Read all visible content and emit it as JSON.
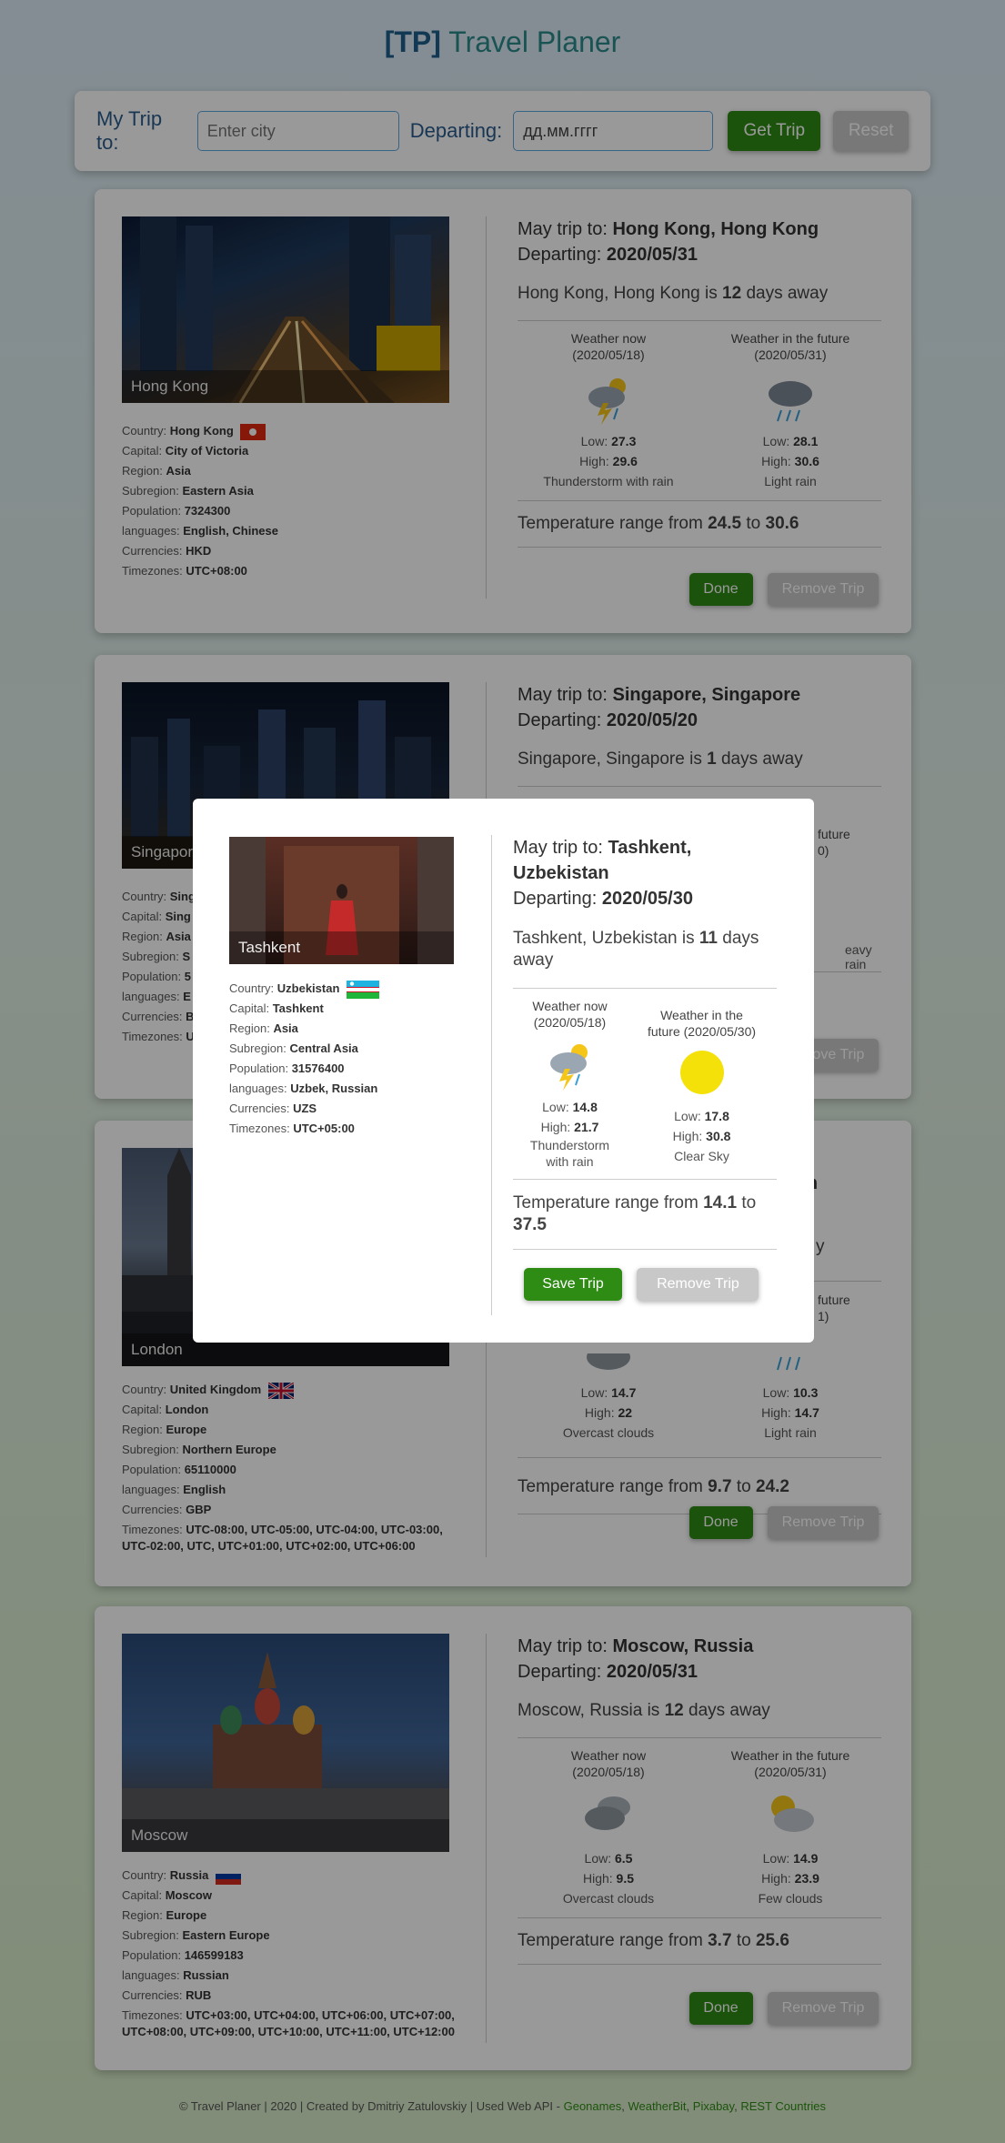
{
  "header": {
    "brand": "[TP]",
    "title": "Travel Planer"
  },
  "form": {
    "trip_label": "My Trip to:",
    "city_placeholder": "Enter city",
    "departing_label": "Departing:",
    "date_value": "дд.мм.гггг",
    "get_trip": "Get Trip",
    "reset": "Reset"
  },
  "labels": {
    "trip_prefix": "May trip to:",
    "departing_prefix": "Departing:",
    "days_mid": "is",
    "days_suffix": "days away",
    "weather_now": "Weather now",
    "weather_future": "Weather in the future",
    "low": "Low:",
    "high": "High:",
    "range_prefix": "Temperature range from",
    "range_mid": "to",
    "country": "Country:",
    "capital": "Capital:",
    "region": "Region:",
    "subregion": "Subregion:",
    "population": "Population:",
    "languages": "languages:",
    "currencies": "Currencies:",
    "timezones": "Timezones:",
    "done": "Done",
    "remove_trip": "Remove Trip",
    "save_trip": "Save Trip"
  },
  "trips": [
    {
      "city_label": "Hong Kong",
      "destination": "Hong Kong, Hong Kong",
      "departing": "2020/05/31",
      "days": "12",
      "now_date": "(2020/05/18)",
      "future_date": "(2020/05/31)",
      "now_icon": "thunderstorm-icon",
      "future_icon": "rain-icon",
      "now_low": "27.3",
      "now_high": "29.6",
      "now_desc": "Thunderstorm with rain",
      "future_low": "28.1",
      "future_high": "30.6",
      "future_desc": "Light rain",
      "range_low": "24.5",
      "range_high": "30.6",
      "country": "Hong Kong",
      "capital": "City of Victoria",
      "region": "Asia",
      "subregion": "Eastern Asia",
      "population": "7324300",
      "languages": "English, Chinese",
      "currencies": "HKD",
      "timezones": "UTC+08:00"
    },
    {
      "city_label": "Singapore",
      "destination": "Singapore, Singapore",
      "departing": "2020/05/20",
      "days": "1",
      "future_desc_partial": "eavy rain",
      "country_partial": "Sing",
      "capital_partial": "Sing",
      "region_partial": "Asia",
      "subregion_partial": "S",
      "population_partial": "5",
      "languages_partial": "E",
      "currencies_partial": "B",
      "timezones_partial": "U",
      "future_head_partial": "future",
      "future_date_partial": "0)"
    },
    {
      "city_label": "London",
      "title_partial": "om",
      "days_partial": "y",
      "future_head_partial": "future",
      "future_date_partial": "1)",
      "now_low": "14.7",
      "now_high": "22",
      "now_desc": "Overcast clouds",
      "future_low": "10.3",
      "future_high": "14.7",
      "future_desc": "Light rain",
      "range_low": "9.7",
      "range_high": "24.2",
      "country": "United Kingdom",
      "capital": "London",
      "region": "Europe",
      "subregion": "Northern Europe",
      "population": "65110000",
      "languages": "English",
      "currencies": "GBP",
      "timezones_line1": "UTC-08:00, UTC-05:00, UTC-04:00, UTC-03:00,",
      "timezones_line2": "UTC-02:00, UTC, UTC+01:00, UTC+02:00, UTC+06:00"
    },
    {
      "city_label": "Moscow",
      "destination": "Moscow, Russia",
      "departing": "2020/05/31",
      "days": "12",
      "now_date": "(2020/05/18)",
      "future_date": "(2020/05/31)",
      "now_icon": "overcast-clouds-icon",
      "future_icon": "few-clouds-icon",
      "now_low": "6.5",
      "now_high": "9.5",
      "now_desc": "Overcast clouds",
      "future_low": "14.9",
      "future_high": "23.9",
      "future_desc": "Few clouds",
      "range_low": "3.7",
      "range_high": "25.6",
      "country": "Russia",
      "capital": "Moscow",
      "region": "Europe",
      "subregion": "Eastern Europe",
      "population": "146599183",
      "languages": "Russian",
      "currencies": "RUB",
      "timezones_line1": "UTC+03:00, UTC+04:00, UTC+06:00, UTC+07:00,",
      "timezones_line2": "UTC+08:00, UTC+09:00, UTC+10:00, UTC+11:00, UTC+12:00"
    }
  ],
  "modal": {
    "city_label": "Tashkent",
    "destination_line1": "Tashkent,",
    "destination_line2": "Uzbekistan",
    "departing": "2020/05/30",
    "days_line1_prefix": "Tashkent, Uzbekistan is",
    "days": "11",
    "days_line1_suffix": "days",
    "days_line2": "away",
    "now_head": "Weather now",
    "now_date": "(2020/05/18)",
    "future_head_line1": "Weather in the",
    "future_head_line2": "future (2020/05/30)",
    "now_low": "14.8",
    "now_high": "21.7",
    "now_desc_line1": "Thunderstorm",
    "now_desc_line2": "with rain",
    "future_low": "17.8",
    "future_high": "30.8",
    "future_desc": "Clear Sky",
    "range_low": "14.1",
    "range_high_line2": "37.5",
    "country": "Uzbekistan",
    "capital": "Tashkent",
    "region": "Asia",
    "subregion": "Central Asia",
    "population": "31576400",
    "languages": "Uzbek, Russian",
    "currencies": "UZS",
    "timezones": "UTC+05:00"
  },
  "footer": {
    "text": "© Travel Planer | 2020 | Created by Dmitriy Zatulovskiy | Used Web API -",
    "links": [
      "Geonames",
      "WeatherBit",
      "Pixabay",
      "REST Countries"
    ],
    "sep": ","
  },
  "colors": {
    "accent_green": "#2e8b14",
    "brand_blue": "#1e5f8c",
    "title_teal": "#2c8a8a",
    "disabled_grey": "#c8c8c8"
  }
}
